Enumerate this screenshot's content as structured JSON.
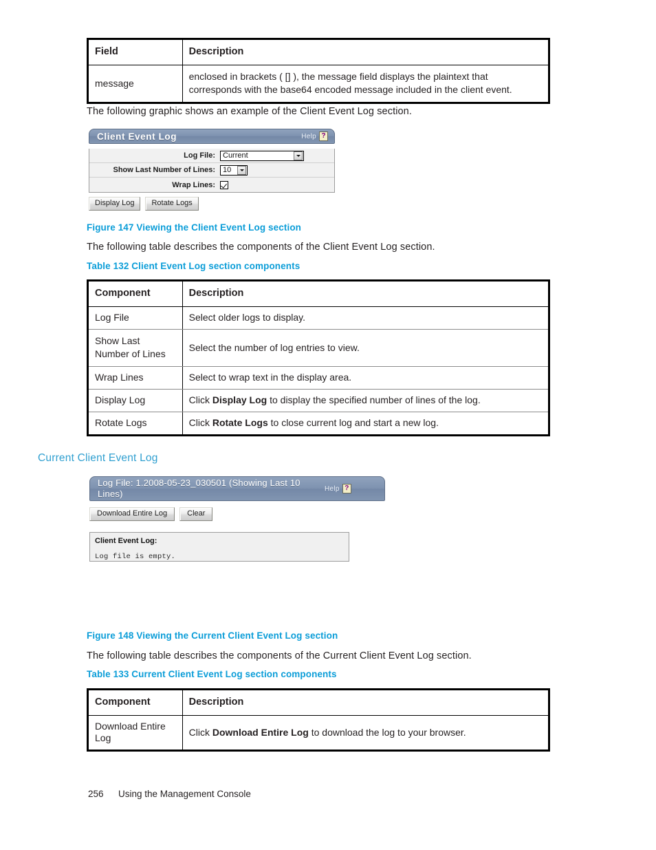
{
  "doc": {
    "page_number": "256",
    "footer_title": "Using the Management Console"
  },
  "table_field": {
    "headers": [
      "Field",
      "Description"
    ],
    "rows": [
      {
        "component": "message",
        "description": "enclosed in brackets ( [] ), the message field displays the plaintext that corresponds with the base64 encoded message included in the client event."
      }
    ]
  },
  "intro_text_1": "The following graphic shows an example of the Client Event Log section.",
  "figure_147": {
    "caption": "Figure 147 Viewing the Client Event Log section"
  },
  "client_event_log_panel": {
    "title": "Client Event Log",
    "help_label": "Help",
    "help_icon": "help-question-icon",
    "fields": [
      {
        "label": "Log File:",
        "type": "select",
        "value": "Current"
      },
      {
        "label": "Show Last Number of Lines:",
        "type": "select",
        "value": "10"
      },
      {
        "label": "Wrap Lines:",
        "type": "checkbox",
        "checked": true
      }
    ],
    "buttons": [
      {
        "label": "Display Log"
      },
      {
        "label": "Rotate Logs"
      }
    ]
  },
  "intro_text_2": "The following table describes the components of the Client Event Log section.",
  "table_132": {
    "caption": "Table 132 Client Event Log section components",
    "headers": [
      "Component",
      "Description"
    ],
    "rows": [
      {
        "component": "Log File",
        "desc_pre": "",
        "desc_bold": "",
        "desc_post": "Select older logs to display."
      },
      {
        "component": "Show Last Number of Lines",
        "desc_pre": "",
        "desc_bold": "",
        "desc_post": "Select the number of log entries to view."
      },
      {
        "component": "Wrap Lines",
        "desc_pre": "",
        "desc_bold": "",
        "desc_post": "Select to wrap text in the display area."
      },
      {
        "component": "Display Log",
        "desc_pre": "Click ",
        "desc_bold": "Display Log",
        "desc_post": " to display the specified number of lines of the log."
      },
      {
        "component": "Rotate Logs",
        "desc_pre": "Click ",
        "desc_bold": "Rotate Logs",
        "desc_post": " to close current log and start a new log."
      }
    ]
  },
  "section_heading": "Current Client Event Log",
  "current_log_panel": {
    "title": "Log File: 1.2008-05-23_030501 (Showing Last 10 Lines)",
    "help_label": "Help",
    "help_icon": "help-question-icon",
    "buttons": [
      {
        "label": "Download Entire Log"
      },
      {
        "label": "Clear"
      }
    ],
    "log_box": {
      "title": "Client Event Log:",
      "content": "Log file is empty."
    }
  },
  "figure_148": {
    "caption": "Figure 148 Viewing the Current Client Event Log section"
  },
  "intro_text_3": "The following table describes the components of the Current Client Event Log section.",
  "table_133": {
    "caption": "Table 133 Current Client Event Log section components",
    "headers": [
      "Component",
      "Description"
    ],
    "rows": [
      {
        "component": "Download Entire Log",
        "desc_pre": "Click ",
        "desc_bold": "Download Entire Log",
        "desc_post": " to download the log to your browser."
      }
    ]
  },
  "colors": {
    "caption_blue": "#0b9dd8",
    "heading_blue": "#2f9fd0",
    "panel_header": "#7e92b0",
    "help_icon_bg": "#f4efc8",
    "help_icon_fg": "#800080"
  }
}
